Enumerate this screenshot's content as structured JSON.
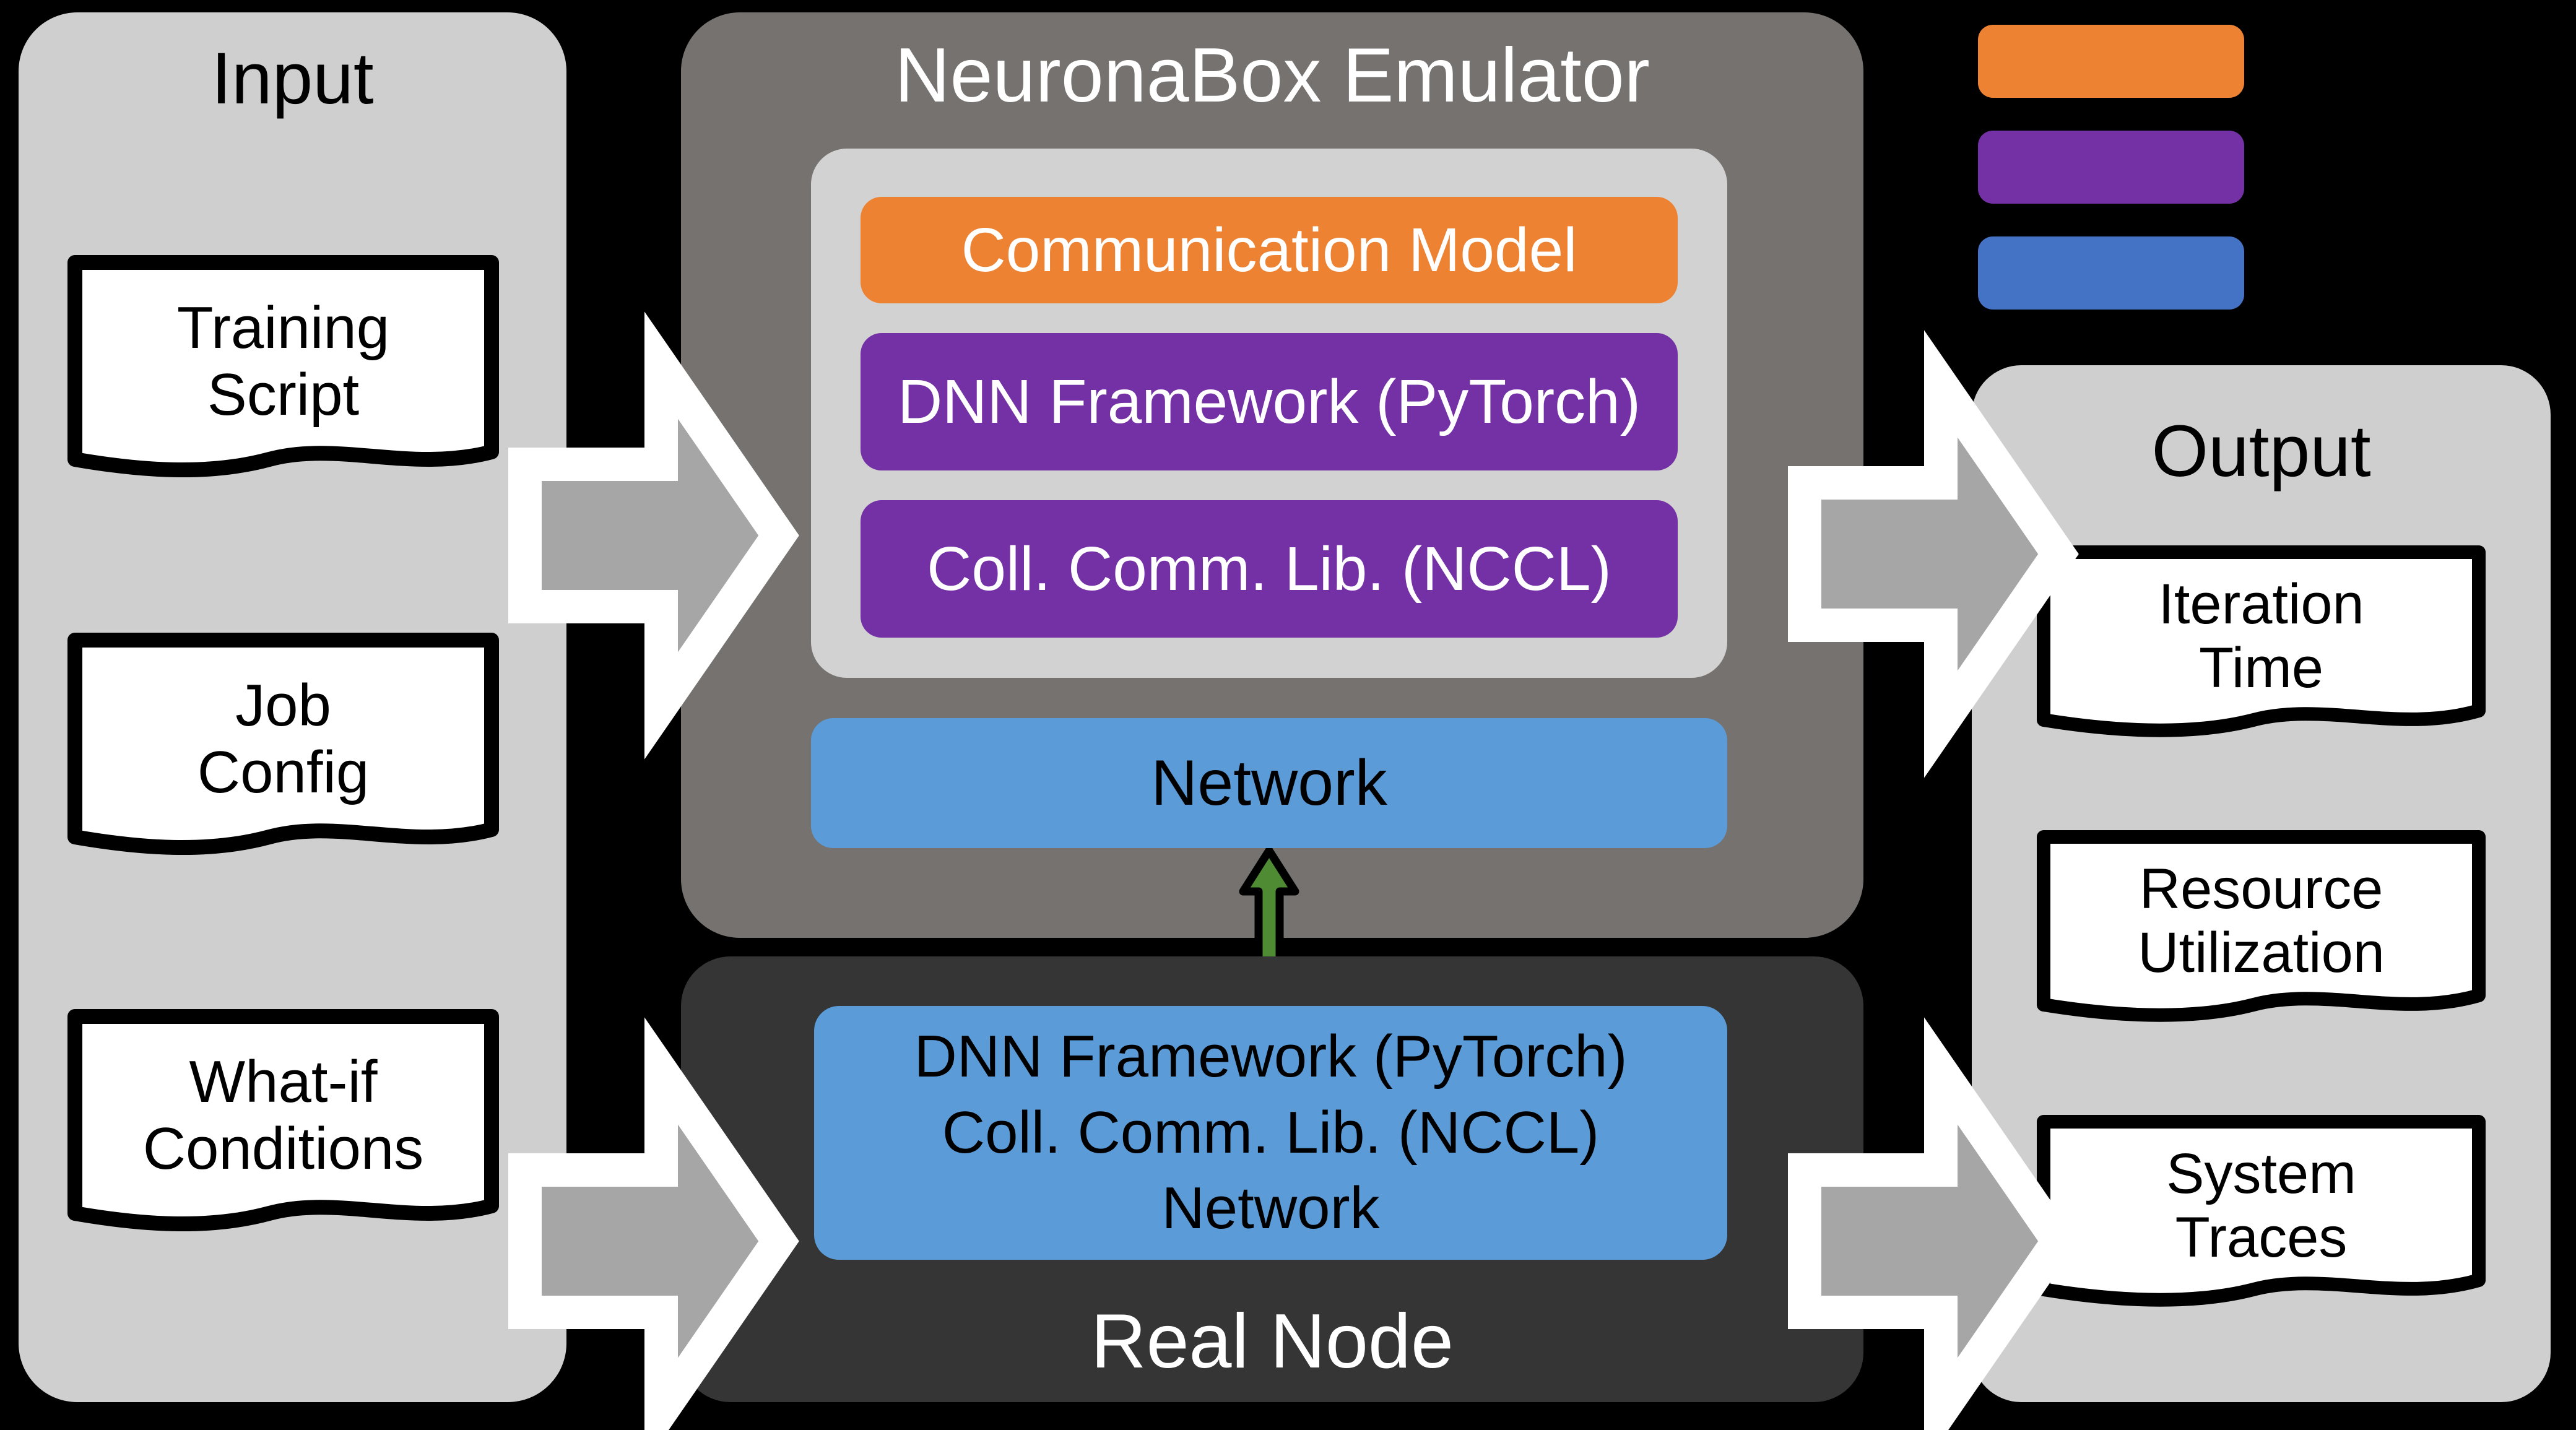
{
  "input": {
    "title": "Input",
    "docs": [
      {
        "lines": [
          "Training",
          "Script"
        ]
      },
      {
        "lines": [
          "Job",
          "Config"
        ]
      },
      {
        "lines": [
          "What-if",
          "Conditions"
        ]
      }
    ]
  },
  "emulator": {
    "title": "NeuronaBox Emulator",
    "layers": [
      {
        "label": "Communication Model",
        "color": "#ED8233"
      },
      {
        "label": "DNN Framework (PyTorch)",
        "color": "#7431A6"
      },
      {
        "label": "Coll. Comm. Lib. (NCCL)",
        "color": "#7431A6"
      }
    ],
    "network": {
      "label": "Network",
      "color": "#5B9BD8"
    }
  },
  "real_node": {
    "title": "Real Node",
    "block": {
      "lines": [
        "DNN Framework (PyTorch)",
        "Coll. Comm. Lib. (NCCL)",
        "Network"
      ],
      "color": "#5B9BD8"
    }
  },
  "output": {
    "title": "Output",
    "docs": [
      {
        "lines": [
          "Iteration",
          "Time"
        ]
      },
      {
        "lines": [
          "Resource",
          "Utilization"
        ]
      },
      {
        "lines": [
          "System",
          "Traces"
        ]
      }
    ]
  },
  "legend": {
    "swatches": [
      {
        "color": "#ED8233"
      },
      {
        "color": "#7431A6"
      },
      {
        "color": "#4472C4"
      }
    ]
  },
  "connector": {
    "green_arrow_color": "#4E8B32",
    "green_arrow_outline": "#000000"
  },
  "colors": {
    "background": "#000000",
    "panel_light": "#CFCFCF",
    "panel_emulator": "#767270",
    "panel_realnode": "#353535",
    "inner_stack": "#D2D2D2",
    "block_arrow_fill": "#A6A6A6",
    "block_arrow_outline": "#FFFFFF"
  }
}
